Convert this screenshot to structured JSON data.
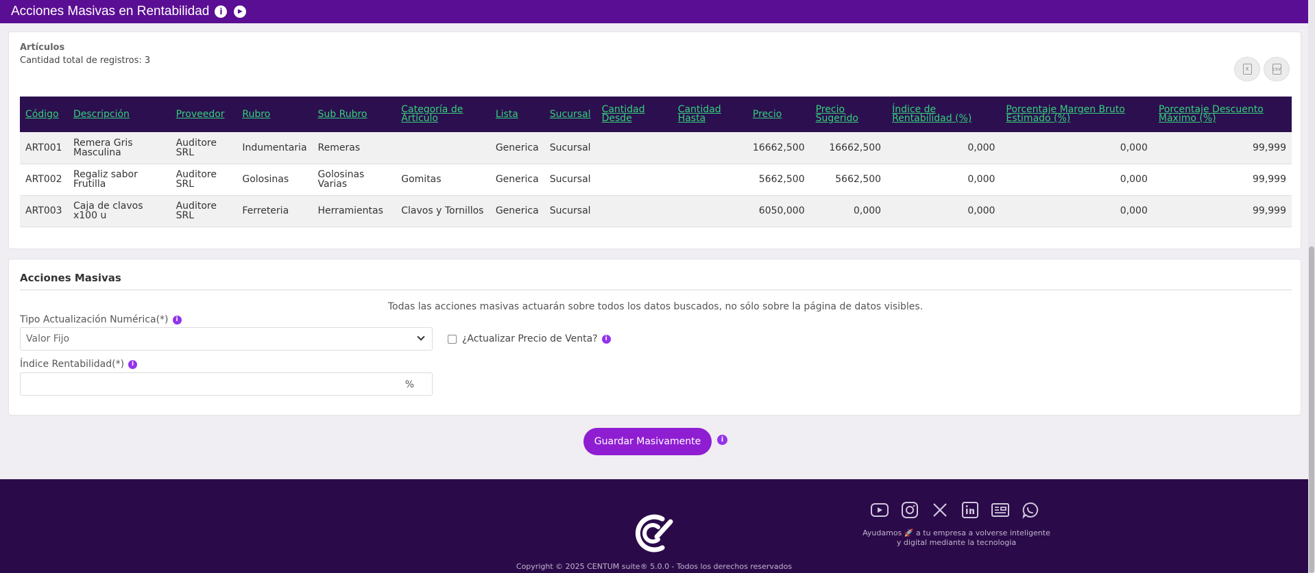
{
  "header": {
    "title": "Acciones Masivas en Rentabilidad",
    "info_icon": "info-icon",
    "play_icon": "play-icon"
  },
  "articulos": {
    "title": "Artículos",
    "count_text": "Cantidad total de registros: 3",
    "export_excel_icon": "excel-file-icon",
    "export_csv_icon": "csv-file-icon",
    "columns": [
      "Código",
      "Descripción",
      "Proveedor",
      "Rubro",
      "Sub Rubro",
      "Categoría de Artículo",
      "Lista",
      "Sucursal",
      "Cantidad Desde",
      "Cantidad Hasta",
      "Precio",
      "Precio Sugerido",
      "Índice de Rentabilidad (%)",
      "Porcentaje Margen Bruto Estimado (%)",
      "Porcentaje Descuento Máximo (%)"
    ],
    "rows": [
      [
        "ART001",
        "Remera Gris Masculina",
        "Auditore SRL",
        "Indumentaria",
        "Remeras",
        "",
        "Generica",
        "Sucursal",
        "",
        "",
        "16662,500",
        "16662,500",
        "0,000",
        "0,000",
        "99,999"
      ],
      [
        "ART002",
        "Regaliz sabor Frutilla",
        "Auditore SRL",
        "Golosinas",
        "Golosinas Varias",
        "Gomitas",
        "Generica",
        "Sucursal",
        "",
        "",
        "5662,500",
        "5662,500",
        "0,000",
        "0,000",
        "99,999"
      ],
      [
        "ART003",
        "Caja de clavos x100 u",
        "Auditore SRL",
        "Ferreteria",
        "Herramientas",
        "Clavos y Tornillos",
        "Generica",
        "Sucursal",
        "",
        "",
        "6050,000",
        "0,000",
        "0,000",
        "0,000",
        "99,999"
      ]
    ]
  },
  "acciones": {
    "title": "Acciones Masivas",
    "notice": "Todas las acciones masivas actuarán sobre todos los datos buscados, no sólo sobre la página de datos visibles.",
    "tipo_label": "Tipo Actualización Numérica(*)",
    "tipo_value": "Valor Fijo",
    "actualizar_label": "¿Actualizar Precio de Venta?",
    "indice_label": "Índice Rentabilidad(*)",
    "indice_unit": "%",
    "indice_value": ""
  },
  "save_button": "Guardar Masivamente",
  "footer": {
    "tagline_line1": "Ayudamos 🚀 a tu empresa a volverse inteligente",
    "tagline_line2": "y digital mediante la tecnologia",
    "copyright": "Copyright © 2025 CENTUM suite® 5.0.0 - Todos los derechos reservados",
    "social_icons": [
      "youtube-icon",
      "instagram-icon",
      "x-icon",
      "linkedin-icon",
      "news-icon",
      "whatsapp-icon"
    ]
  },
  "colors": {
    "header_bg": "#5a0e93",
    "table_header_bg": "#2c0f4f",
    "table_header_text": "#33d17a",
    "accent": "#8f1ed2",
    "footer_bg": "#2b0a4a"
  }
}
